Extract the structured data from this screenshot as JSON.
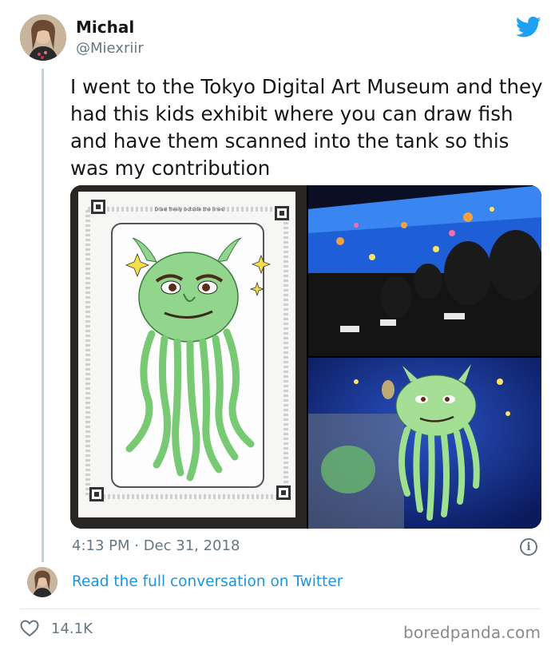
{
  "author": {
    "name": "Michal",
    "handle": "@Miexriir"
  },
  "tweet": {
    "text": "I went to the Tokyo Digital Art Museum and they had this kids exhibit where you can draw fish and have them scanned into the tank so this was my contribution",
    "timestamp": "4:13 PM · Dec 31, 2018",
    "likes": "14.1K"
  },
  "photos": [
    {
      "description_icon": "drawing-photo",
      "header_text": "Draw freely outside the lines!"
    },
    {
      "description_icon": "museum-room-photo"
    },
    {
      "description_icon": "digital-tank-photo"
    }
  ],
  "footer": {
    "read_link": "Read the full conversation on Twitter"
  },
  "watermark": "boredpanda.com",
  "colors": {
    "link": "#1b95e0",
    "twitter_blue": "#1da1f2",
    "secondary_text": "#657786",
    "divider": "#e1e8ed"
  },
  "icons": [
    "twitter-bird-icon",
    "info-icon",
    "heart-icon"
  ]
}
